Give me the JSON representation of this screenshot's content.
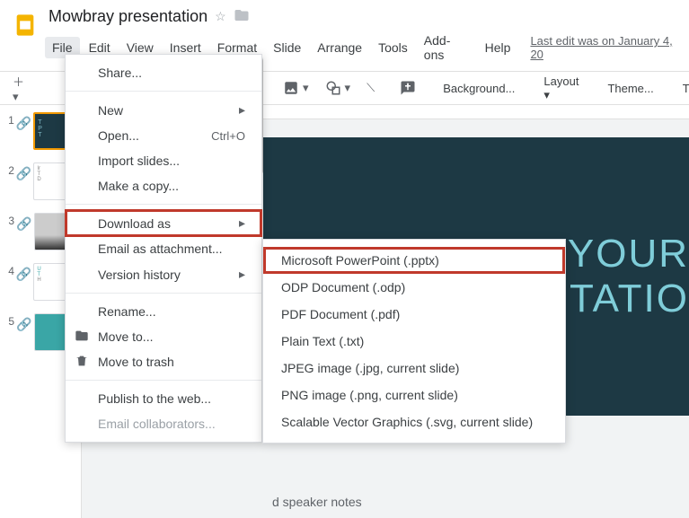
{
  "doc_title": "Mowbray presentation",
  "last_edit": "Last edit was on January 4, 20",
  "menubar": [
    {
      "label": "File",
      "active": true
    },
    {
      "label": "Edit",
      "active": false
    },
    {
      "label": "View",
      "active": false
    },
    {
      "label": "Insert",
      "active": false
    },
    {
      "label": "Format",
      "active": false
    },
    {
      "label": "Slide",
      "active": false
    },
    {
      "label": "Arrange",
      "active": false
    },
    {
      "label": "Tools",
      "active": false
    },
    {
      "label": "Add-ons",
      "active": false
    },
    {
      "label": "Help",
      "active": false
    }
  ],
  "toolbar": {
    "background": "Background...",
    "layout": "Layout",
    "theme": "Theme...",
    "transition": "Transition..."
  },
  "file_menu": {
    "share": "Share...",
    "new": "New",
    "open": "Open...",
    "open_shortcut": "Ctrl+O",
    "import_slides": "Import slides...",
    "make_copy": "Make a copy...",
    "download_as": "Download as",
    "email_attachment": "Email as attachment...",
    "version_history": "Version history",
    "rename": "Rename...",
    "move_to": "Move to...",
    "move_to_trash": "Move to trash",
    "publish_web": "Publish to the web...",
    "email_collaborators": "Email collaborators..."
  },
  "download_submenu": [
    {
      "label": "Microsoft PowerPoint (.pptx)",
      "highlight": true
    },
    {
      "label": "ODP Document (.odp)",
      "highlight": false
    },
    {
      "label": "PDF Document (.pdf)",
      "highlight": false
    },
    {
      "label": "Plain Text (.txt)",
      "highlight": false
    },
    {
      "label": "JPEG image (.jpg, current slide)",
      "highlight": false
    },
    {
      "label": "PNG image (.png, current slide)",
      "highlight": false
    },
    {
      "label": "Scalable Vector Graphics (.svg, current slide)",
      "highlight": false
    }
  ],
  "slide": {
    "line1": "THIS IS YOUR",
    "line2": "ENTATIO"
  },
  "thumbnails": {
    "n1": "1",
    "n2": "2",
    "n3": "3",
    "n4": "4",
    "n5": "5"
  },
  "speaker_notes": "d speaker notes"
}
